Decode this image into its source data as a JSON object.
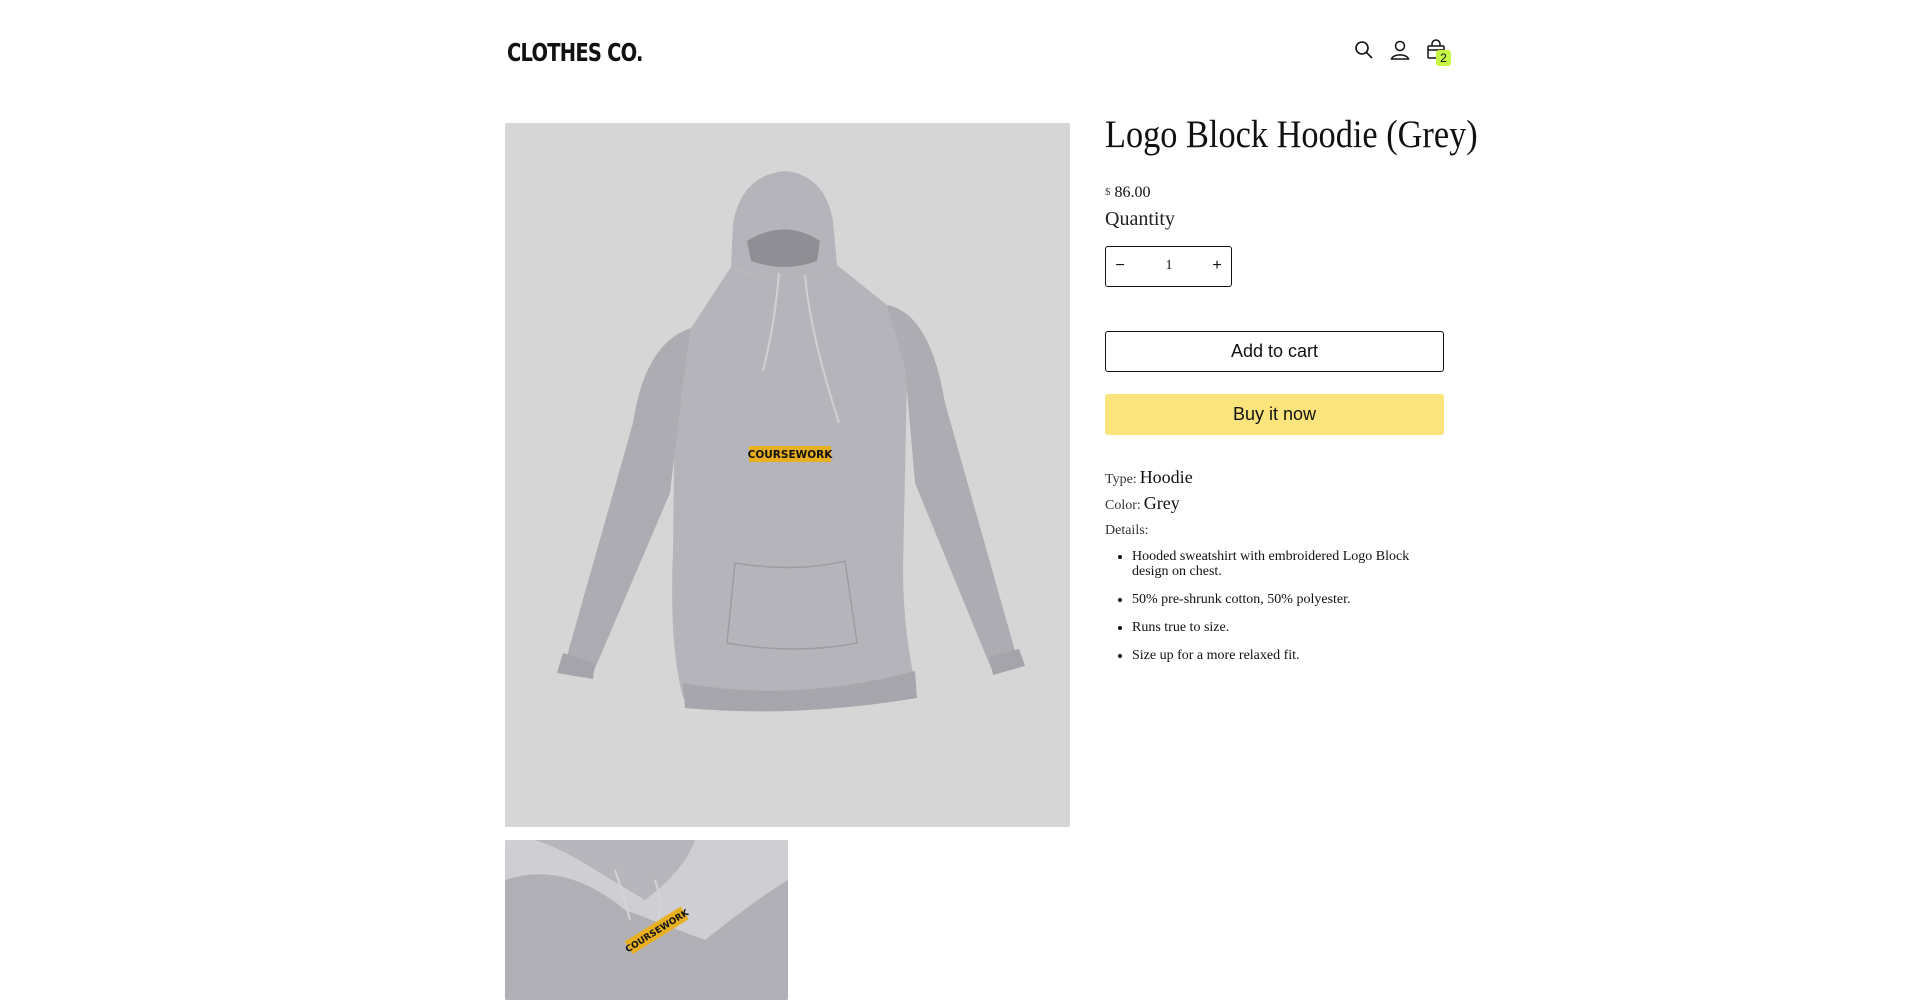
{
  "header": {
    "logo": "CLOTHES CO.",
    "icons": [
      "search-icon",
      "account-icon",
      "cart-icon"
    ],
    "cart_count": "2"
  },
  "product": {
    "title": "Logo Block Hoodie (Grey)",
    "currency": "$",
    "price": "86.00",
    "quantity_label": "Quantity",
    "quantity": "1",
    "minus_label": "−",
    "plus_label": "+",
    "add_to_cart": "Add to cart",
    "buy_now": "Buy it now",
    "type_label": "Type:",
    "type_value": "Hoodie",
    "color_label": "Color:",
    "color_value": "Grey",
    "details_label": "Details:",
    "details": [
      "Hooded sweatshirt with embroidered Logo Block design on chest.",
      "50% pre-shrunk cotton, 50% polyester.",
      "Runs true to size.",
      "Size up for a more relaxed fit."
    ],
    "image_text": "COURSEWORK"
  },
  "colors": {
    "buy_button": "#fbe47c",
    "cart_badge": "#c6f542",
    "image_bg": "#d6d6d6",
    "hoodie": "#b4b4ba",
    "patch": "#e8b020"
  }
}
